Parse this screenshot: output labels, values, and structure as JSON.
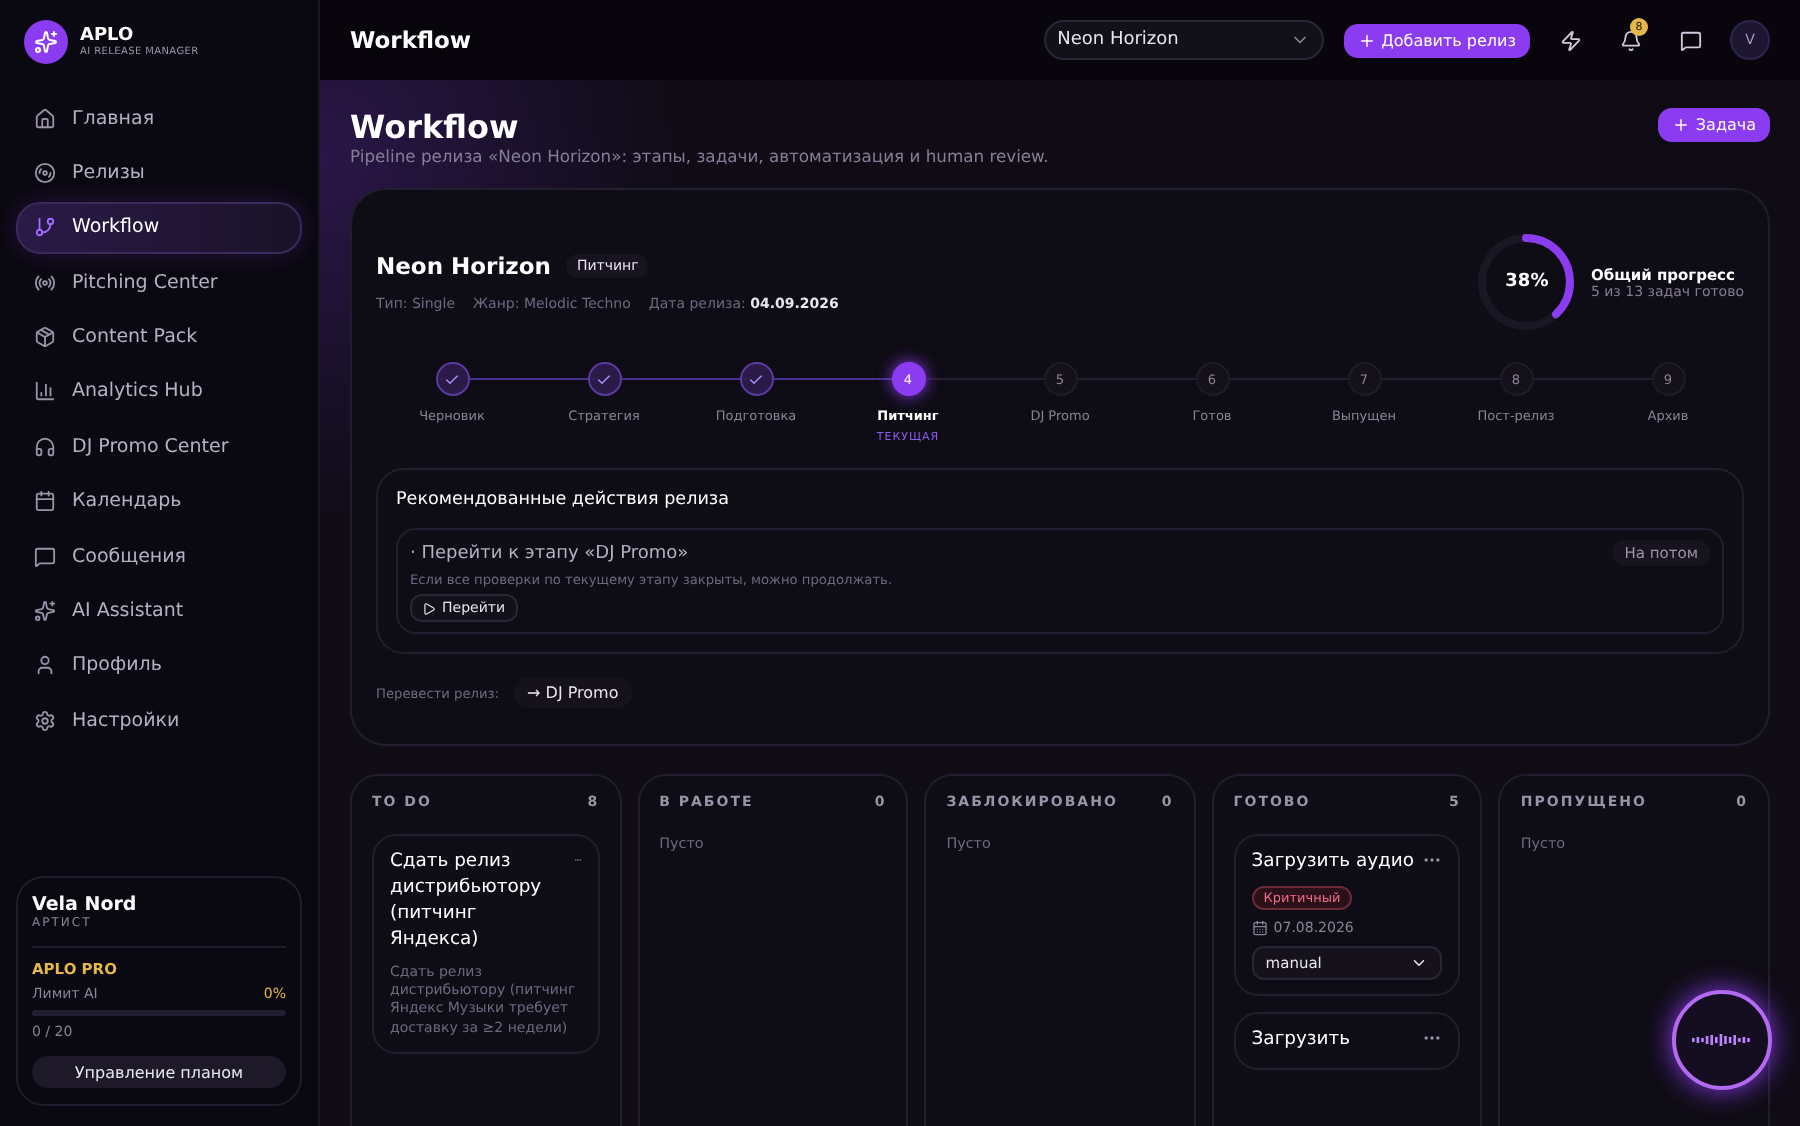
{
  "brand": {
    "name": "APLO",
    "tagline": "AI RELEASE MANAGER"
  },
  "sidebar": {
    "items": [
      {
        "label": "Главная",
        "selected": false
      },
      {
        "label": "Релизы",
        "selected": false
      },
      {
        "label": "Workflow",
        "selected": true
      },
      {
        "label": "Pitching Center",
        "selected": false
      },
      {
        "label": "Content Pack",
        "selected": false
      },
      {
        "label": "Analytics Hub",
        "selected": false
      },
      {
        "label": "DJ Promo Center",
        "selected": false
      },
      {
        "label": "Календарь",
        "selected": false
      },
      {
        "label": "Сообщения",
        "selected": false
      },
      {
        "label": "AI Assistant",
        "selected": false
      },
      {
        "label": "Профиль",
        "selected": false
      },
      {
        "label": "Настройки",
        "selected": false
      }
    ],
    "user": {
      "name": "Vela Nord",
      "role": "АРТИСТ",
      "plan": "APLO PRO",
      "limit_label": "Лимит AI",
      "limit_percent": "0%",
      "level": 0,
      "usage": "0 / 20",
      "button": "Управление планом"
    }
  },
  "header": {
    "title": "Workflow",
    "release_select": "Neon Horizon",
    "add_button": "Добавить релиз",
    "notifications": "8",
    "avatar": "V"
  },
  "page": {
    "title": "Workflow",
    "subtitle": "Pipeline релиза «Neon Horizon»: этапы, задачи, автоматизация и human review.",
    "task_button": "Задача"
  },
  "release": {
    "name": "Neon Horizon",
    "stage_badge": "Питчинг",
    "meta": [
      {
        "label": "Тип: Single"
      },
      {
        "label": "Жанр: Melodic Techno"
      },
      {
        "label": "Дата релиза:",
        "value": "04.09.2026"
      }
    ],
    "progress": {
      "percent": "38%",
      "level": 0.38,
      "title": "Общий прогресс",
      "caption": "5 из 13 задач готово"
    },
    "steps": [
      {
        "label": "Черновик",
        "done": true,
        "selected": false
      },
      {
        "label": "Стратегия",
        "done": true,
        "selected": false
      },
      {
        "label": "Подготовка",
        "done": true,
        "selected": false
      },
      {
        "marker": "4",
        "label": "Питчинг",
        "done": false,
        "selected": true,
        "note": "ТЕКУЩАЯ"
      },
      {
        "marker": "5",
        "label": "DJ Promo",
        "done": false,
        "selected": false
      },
      {
        "marker": "6",
        "label": "Готов",
        "done": false,
        "selected": false
      },
      {
        "marker": "7",
        "label": "Выпущен",
        "done": false,
        "selected": false
      },
      {
        "marker": "8",
        "label": "Пост-релиз",
        "done": false,
        "selected": false
      },
      {
        "marker": "9",
        "label": "Архив",
        "done": false,
        "selected": false
      }
    ],
    "recommendations": {
      "title": "Рекомендованные действия релиза",
      "items": [
        {
          "bullet": "·",
          "title": "Перейти к этапу «DJ Promo»",
          "description": "Если все проверки по текущему этапу закрыты, можно продолжать.",
          "badge": "На потом",
          "action": "Перейти"
        }
      ]
    },
    "transition": {
      "label": "Перевести релиз:",
      "button": "→ DJ Promo"
    }
  },
  "board": {
    "columns": [
      {
        "title": "TO DO",
        "count": "8",
        "cards": [
          {
            "title": "Сдать релиз дистрибьютору (питчинг Яндекса)",
            "description": "Сдать релиз дистрибьютору (питчинг Яндекс Музыки требует доставку за ≥2 недели)"
          }
        ]
      },
      {
        "title": "В РАБОТЕ",
        "count": "0",
        "empty": "Пусто"
      },
      {
        "title": "ЗАБЛОКИРОВАНО",
        "count": "0",
        "empty": "Пусто"
      },
      {
        "title": "ГОТОВО",
        "count": "5",
        "cards": [
          {
            "title": "Загрузить аудио",
            "priority": "Критичный",
            "date": "07.08.2026",
            "mode": "manual"
          },
          {
            "title": "Загрузить"
          }
        ]
      },
      {
        "title": "ПРОПУЩЕНО",
        "count": "0",
        "empty": "Пусто"
      }
    ]
  }
}
